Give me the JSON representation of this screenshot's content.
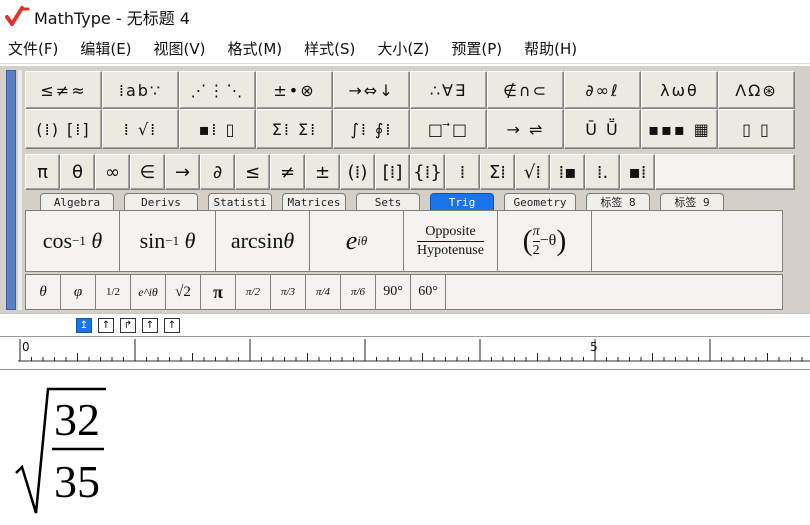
{
  "window": {
    "title": "MathType - 无标题 4",
    "logo_icon": "mathtype-logo-icon",
    "logo_color": "#e0322b"
  },
  "menu": [
    {
      "label": "文件(F)"
    },
    {
      "label": "编辑(E)"
    },
    {
      "label": "视图(V)"
    },
    {
      "label": "格式(M)"
    },
    {
      "label": "样式(S)"
    },
    {
      "label": "大小(Z)"
    },
    {
      "label": "预置(P)"
    },
    {
      "label": "帮助(H)"
    }
  ],
  "palettes": {
    "row1": [
      "≤≠≈",
      "⁞ab∵",
      "⋰⋮⋱",
      "±•⊗",
      "→⇔↓",
      "∴∀∃",
      "∉∩⊂",
      "∂∞ℓ",
      "λωθ",
      "ΛΩ⊛"
    ],
    "row2": [
      "(⁞) [⁞]",
      "⁞ √⁞",
      "▪⁞ ▯",
      "Σ⁞ Σ⁞",
      "∫⁞ ∮⁞",
      "□ ⃗□",
      "→ ⇌",
      "Ū Ṻ",
      "▪▪▪ ▦",
      "▯ ▯"
    ],
    "row3": [
      "π",
      "θ",
      "∞",
      "∈",
      "→",
      "∂",
      "≤",
      "≠",
      "±",
      "(⁞)",
      "[⁞]",
      "{⁞}",
      "⁞",
      "Σ⁞",
      "√⁞",
      "⁞▪",
      "⁞.",
      "▪⁞"
    ]
  },
  "tabs": [
    {
      "label": "Algebra",
      "active": false
    },
    {
      "label": "Derivs",
      "active": false
    },
    {
      "label": "Statisti",
      "active": false
    },
    {
      "label": "Matrices",
      "active": false
    },
    {
      "label": "Sets",
      "active": false
    },
    {
      "label": "Trig",
      "active": true
    },
    {
      "label": "Geometry",
      "active": false
    },
    {
      "label": "标签 8",
      "active": false
    },
    {
      "label": "标签 9",
      "active": false
    }
  ],
  "trig_templates": {
    "cos_inv": {
      "base": "cos",
      "sup": "−1",
      "var": "θ"
    },
    "sin_inv": {
      "base": "sin",
      "sup": "−1",
      "var": "θ"
    },
    "arcsin": {
      "base": "arcsin",
      "var": "θ"
    },
    "exp": {
      "base": "e",
      "sup": "iθ"
    },
    "ratio": {
      "num": "Opposite",
      "den": "Hypotenuse"
    },
    "shift": {
      "num": "π",
      "den": "2",
      "rest": "−θ"
    }
  },
  "small_templates": [
    "θ",
    "φ",
    "1/2",
    "e^iθ",
    "√2",
    "π",
    "π/2",
    "π/3",
    "π/4",
    "π/6",
    "90°",
    "60°"
  ],
  "ruler": {
    "labels": [
      "0",
      "5"
    ]
  },
  "document": {
    "expression": "√(32/35)",
    "numerator": "32",
    "denominator": "35"
  },
  "colors": {
    "accent": "#1a73e8",
    "toolbar_bg": "#d4d0c8",
    "strip": "#5b7fc7"
  }
}
